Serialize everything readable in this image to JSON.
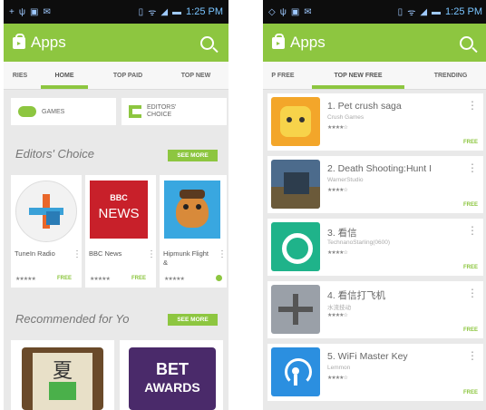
{
  "status_bar": {
    "time": "1:25 PM"
  },
  "app_bar": {
    "title": "Apps"
  },
  "left_screen": {
    "tabs": [
      "RIES",
      "HOME",
      "TOP PAID",
      "TOP NEW"
    ],
    "categories": [
      {
        "label": "GAMES"
      },
      {
        "label": "EDITORS' CHOICE"
      }
    ],
    "editors_choice": {
      "title": "Editors' Choice",
      "see_more": "SEE MORE",
      "apps": [
        {
          "name": "TuneIn Radio",
          "price": "FREE"
        },
        {
          "name": "BBC News",
          "price": "FREE",
          "logo_top": "BBC",
          "logo_bottom": "NEWS"
        },
        {
          "name": "Hipmunk Flight &",
          "price": ""
        }
      ]
    },
    "recommended": {
      "title": "Recommended for Yo",
      "see_more": "SEE MORE",
      "apps": [
        {
          "name": "",
          "glyph": "夏"
        },
        {
          "name": "",
          "logo_top": "BET",
          "logo_bottom": "AWARDS"
        }
      ]
    }
  },
  "right_screen": {
    "tabs": [
      "P FREE",
      "TOP NEW FREE",
      "TRENDING"
    ],
    "apps": [
      {
        "title": "1. Pet crush saga",
        "developer": "Crush Games",
        "price": "FREE",
        "icon_color": "#f3a62a"
      },
      {
        "title": "2. Death Shooting:Hunt I",
        "developer": "WarnerStudio",
        "price": "FREE",
        "icon_color": "#4c6b8c"
      },
      {
        "title": "3. 看信",
        "developer": "TechnanoStarling(0600)",
        "price": "FREE",
        "icon_color": "#1fb38a"
      },
      {
        "title": "4. 看信打飞机",
        "developer": "水流技动",
        "price": "FREE",
        "icon_color": "#9aa0a8"
      },
      {
        "title": "5. WiFi Master Key",
        "developer": "Lemmon",
        "price": "FREE",
        "icon_color": "#2b8fe0"
      }
    ]
  },
  "colors": {
    "accent": "#8dc640",
    "status_bar": "#0d0d0d",
    "background": "#e9e9e9"
  }
}
